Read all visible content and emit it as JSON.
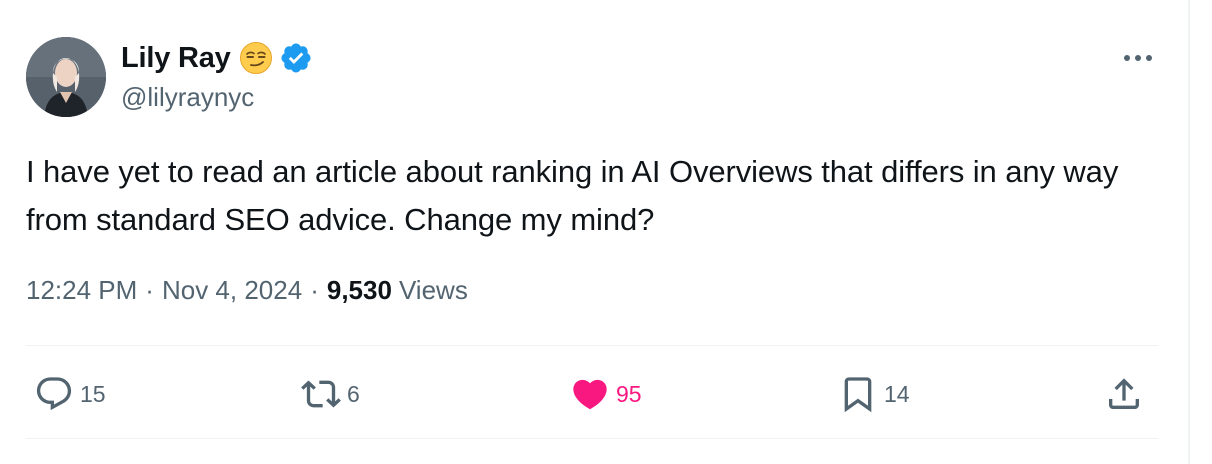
{
  "author": {
    "name": "Lily Ray",
    "handle": "@lilyraynyc",
    "emoji_icon": "smirking-face-emoji",
    "verified_icon": "verified-badge-icon",
    "verified_color": "#1d9bf0"
  },
  "tweet": {
    "text": "I have yet to read an article about ranking in AI Overviews that differs in any way from standard SEO advice. Change my mind?"
  },
  "meta": {
    "time": "12:24 PM",
    "separator": "·",
    "date": "Nov 4, 2024",
    "views_count": "9,530",
    "views_label": "Views"
  },
  "actions": {
    "reply": {
      "icon": "reply-icon",
      "count": "15"
    },
    "retweet": {
      "icon": "retweet-icon",
      "count": "6"
    },
    "like": {
      "icon": "heart-icon",
      "count": "95",
      "color": "#f91880"
    },
    "bookmark": {
      "icon": "bookmark-icon",
      "count": "14"
    },
    "share": {
      "icon": "share-icon"
    }
  },
  "more_icon": "more-options-icon",
  "colors": {
    "text_primary": "#0f1419",
    "text_secondary": "#536471",
    "divider": "#eff3f4"
  }
}
